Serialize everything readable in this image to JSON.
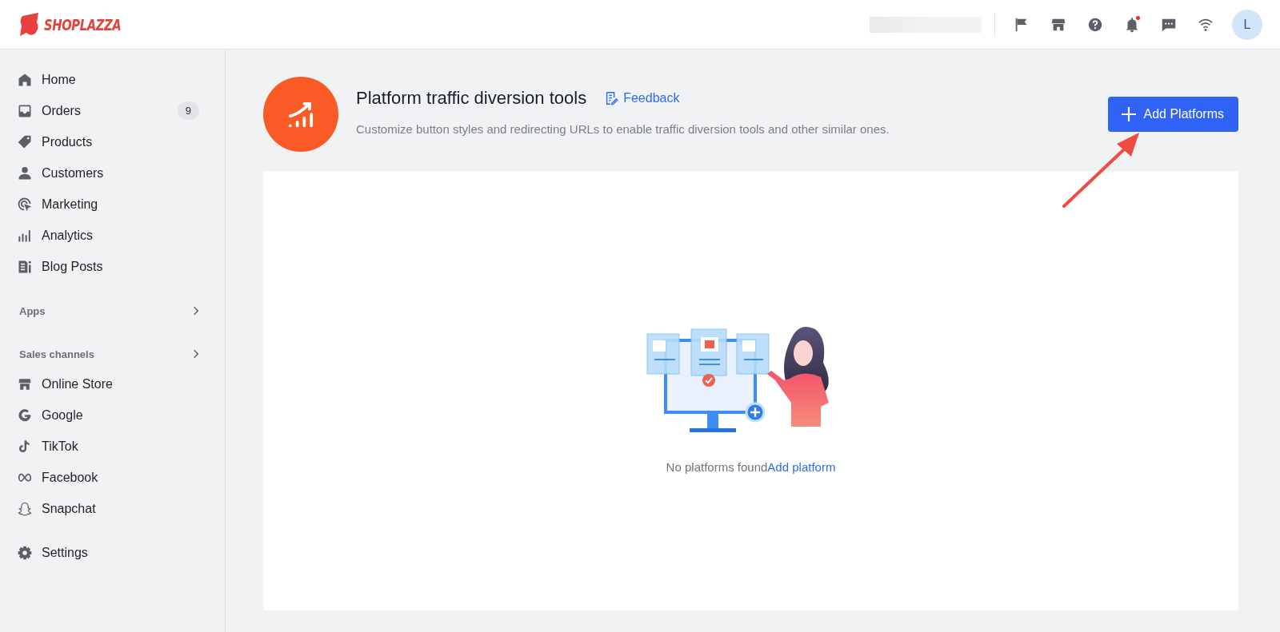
{
  "top_bar": {
    "logo": "SHOPLAZZA",
    "icons": [
      {
        "kind": "flag"
      },
      {
        "kind": "store"
      },
      {
        "kind": "help"
      },
      {
        "kind": "bell",
        "unread": true
      },
      {
        "kind": "chat"
      },
      {
        "kind": "wifi"
      }
    ],
    "avatar": "L"
  },
  "sidebar": {
    "items": [
      {
        "kind": "home",
        "label": "Home"
      },
      {
        "kind": "orders",
        "label": "Orders",
        "badge": "9"
      },
      {
        "kind": "tag",
        "label": "Products"
      },
      {
        "kind": "person",
        "label": "Customers"
      },
      {
        "kind": "marketing",
        "label": "Marketing"
      },
      {
        "kind": "chart",
        "label": "Analytics"
      },
      {
        "kind": "blog",
        "label": "Blog Posts"
      }
    ],
    "sections": [
      {
        "title": "Apps"
      },
      {
        "title": "Sales channels",
        "items": [
          {
            "kind": "store",
            "label": "Online Store"
          },
          {
            "kind": "google",
            "label": "Google"
          },
          {
            "kind": "tiktok",
            "label": "TikTok"
          },
          {
            "kind": "meta",
            "label": "Facebook"
          },
          {
            "kind": "ghost",
            "label": "Snapchat"
          }
        ]
      }
    ],
    "footer_items": [
      {
        "kind": "gear",
        "label": "Settings"
      }
    ]
  },
  "page": {
    "title": "Platform traffic diversion tools",
    "feedback": "Feedback",
    "description": "Customize button styles and redirecting URLs to enable traffic diversion tools and other similar ones.",
    "primary_button": "Add Platforms",
    "empty_state": {
      "message": "No platforms found",
      "link": "Add platform"
    }
  }
}
